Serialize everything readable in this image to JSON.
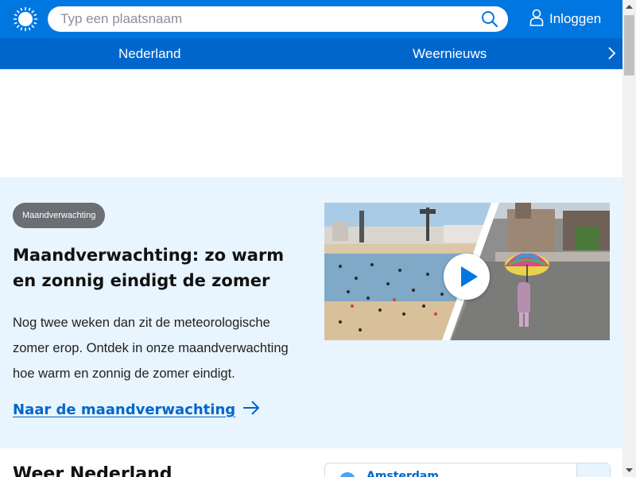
{
  "header": {
    "search_placeholder": "Typ een plaatsnaam",
    "login_label": "Inloggen",
    "logo_icon": "sun-logo-icon",
    "search_icon": "search-icon",
    "user_icon": "user-icon",
    "brand_color": "#0076e0"
  },
  "nav": {
    "items": [
      {
        "label": "Nederland"
      },
      {
        "label": "Weernieuws"
      }
    ],
    "next_icon": "chevron-right-icon",
    "color": "#0066cc"
  },
  "feature": {
    "badge": "Maandverwachting",
    "title": "Maandverwachting: zo warm en zonnig eindigt de zomer",
    "text": "Nog twee weken dan zit de meteorologische zomer erop. Ontdek in onze maandverwachting hoe warm en zonnig de zomer eindigt.",
    "link_label": "Naar de maandverwachting",
    "link_icon": "arrow-right-icon",
    "video_icon": "play-icon",
    "background": "#e8f4fe"
  },
  "weather": {
    "title": "Weer Nederland",
    "city": "Amsterdam"
  }
}
